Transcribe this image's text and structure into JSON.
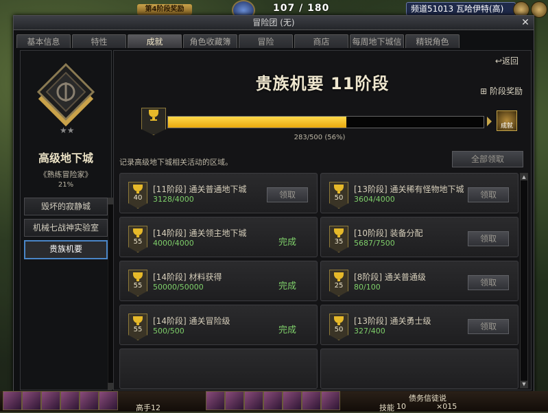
{
  "hud": {
    "title": "第4阶段奖励",
    "hp": "107 / 180",
    "channel": "频道51013 瓦哈伊特(高)"
  },
  "window": {
    "title": "冒险团 (无)",
    "tabs": [
      "基本信息",
      "特性",
      "成就",
      "角色收藏簿",
      "冒险",
      "商店",
      "每周地下城信息",
      "精锐角色"
    ],
    "active_tab": "成就"
  },
  "left": {
    "title": "高级地下城",
    "rank": "《熟练冒险家》",
    "percent": "21%",
    "items": [
      "毁坏的寂静城",
      "机械七战神实验室",
      "贵族机要"
    ],
    "selected": "贵族机要"
  },
  "main": {
    "return_label": "返回",
    "phase_title": "贵族机要 11阶段",
    "phase_reward_label": "阶段奖励",
    "reward_box_label": "成就",
    "progress_fraction": 0.566,
    "progress_text": "283/500 (56%)",
    "description": "记录高级地下城相关活动的区域。",
    "claim_all_label": "全部领取",
    "cards": [
      {
        "level": "40",
        "title": "[11阶段] 通关普通地下城",
        "progress": "3128/4000",
        "state": "领取"
      },
      {
        "level": "50",
        "title": "[13阶段] 通关稀有怪物地下城",
        "progress": "3604/4000",
        "state": "领取"
      },
      {
        "level": "55",
        "title": "[14阶段] 通关领主地下城",
        "progress": "4000/4000",
        "state": "完成"
      },
      {
        "level": "35",
        "title": "[10阶段] 装备分配",
        "progress": "5687/7500",
        "state": "领取"
      },
      {
        "level": "55",
        "title": "[14阶段] 材料获得",
        "progress": "50000/50000",
        "state": "完成"
      },
      {
        "level": "25",
        "title": "[8阶段] 通关普通级",
        "progress": "80/100",
        "state": "领取"
      },
      {
        "level": "55",
        "title": "[14阶段] 通关冒险级",
        "progress": "500/500",
        "state": "完成"
      },
      {
        "level": "50",
        "title": "[13阶段] 通关勇士级",
        "progress": "327/400",
        "state": "领取"
      }
    ]
  },
  "bottom": {
    "player_label": "高手12",
    "skill_label": "技能",
    "skill_count": "10",
    "status_label": "债务信徒说",
    "count_label": "×015"
  },
  "colors": {
    "progress": "#f0b81c",
    "complete": "#7fd06a",
    "selection": "#4a86c8"
  }
}
